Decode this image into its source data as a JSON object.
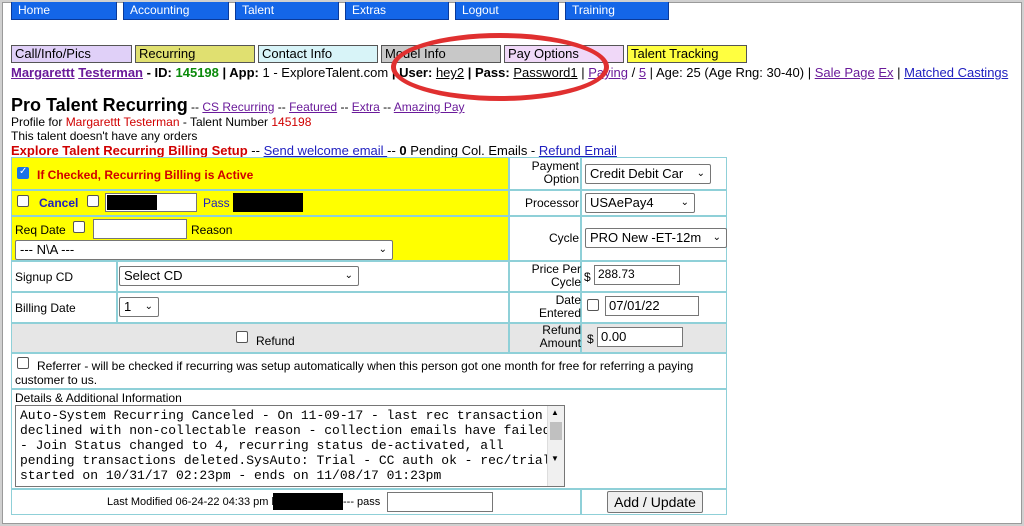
{
  "nav": [
    "Home",
    "Accounting",
    "Talent",
    "Extras",
    "Logout",
    "Training"
  ],
  "tabs": [
    {
      "label": "Call/Info/Pics",
      "color": "#e0d0f8"
    },
    {
      "label": "Recurring",
      "color": "#e0e070"
    },
    {
      "label": "Contact Info",
      "color": "#d8f4f8"
    },
    {
      "label": "Model Info",
      "color": "#c8c8c8"
    },
    {
      "label": "Pay Options",
      "color": "#f0d8f8"
    },
    {
      "label": "Talent Tracking",
      "color": "#ffff40"
    }
  ],
  "profile": {
    "first": "Margarettt",
    "last": "Testerman",
    "id_label": " - ID: ",
    "id": "145198",
    "app_label": " | App: ",
    "app": "1 - ExploreTalent.com",
    "user_label": " | User: ",
    "user": "hey2",
    "pass_label": " | Pass: ",
    "pass": "Password1",
    "paying": "Paying",
    "paying_num": "5",
    "age_text": " | Age: 25 (Age Rng: 30-40) | ",
    "sale_page": "Sale Page",
    "ex": "Ex",
    "matched": "Matched Castings"
  },
  "title": {
    "main": "Pro Talent Recurring",
    "sep": " -- ",
    "links": [
      "CS Recurring",
      "Featured",
      "Extra",
      "Amazing Pay"
    ]
  },
  "lines": {
    "profile_for": "Profile for ",
    "name": "Margarettt Testerman",
    "talent_number": " - Talent Number ",
    "number": "145198",
    "orders": "This talent doesn't have any orders",
    "setup": "Explore Talent Recurring Billing Setup",
    "welcome": "Send welcome email ",
    "pending_count": "0",
    "pending_text": " Pending Col. Emails - ",
    "refund_email": "Refund Email"
  },
  "form": {
    "active_label": "If Checked, Recurring Billing is Active",
    "cancel_label": "Cancel",
    "pass_label": "Pass",
    "req_date_label": "Req Date",
    "reason_label": "Reason",
    "reason_value": "--- N\\A ---",
    "signup_label": "Signup CD",
    "signup_value": "Select CD",
    "billing_label": "Billing Date",
    "billing_value": "1",
    "refund_label": "Refund",
    "payment_label": "Payment Option",
    "payment_value": "Credit Debit Car",
    "processor_label": "Processor",
    "processor_value": "USAePay4",
    "cycle_label": "Cycle",
    "cycle_value": "PRO New -ET-12m",
    "price_label": "Price Per Cycle",
    "price_value": "288.73",
    "date_entered_label": "Date Entered",
    "date_entered_value": "07/01/22",
    "refund_amount_label": "Refund Amount",
    "refund_amount_value": "0.00",
    "currency": "$",
    "referrer_text": "Referrer - will be checked if recurring was setup automatically when this person got one month for free for referring a paying customer to us.",
    "details_label": "Details & Additional Information",
    "details_text": "Auto-System Recurring Canceled - On 11-09-17 - last rec transaction declined with non-collectable reason - collection emails have failed - Join Status changed to 4, recurring status de-activated, all pending transactions deleted.SysAuto: Trial - CC auth ok - rec/trial started on 10/31/17 02:23pm - ends on 11/08/17 01:23pm",
    "last_modified": "Last Modified 06-24-22 04:33 pm by",
    "pass_suffix": "--- pass",
    "submit_label": "Add / Update"
  }
}
